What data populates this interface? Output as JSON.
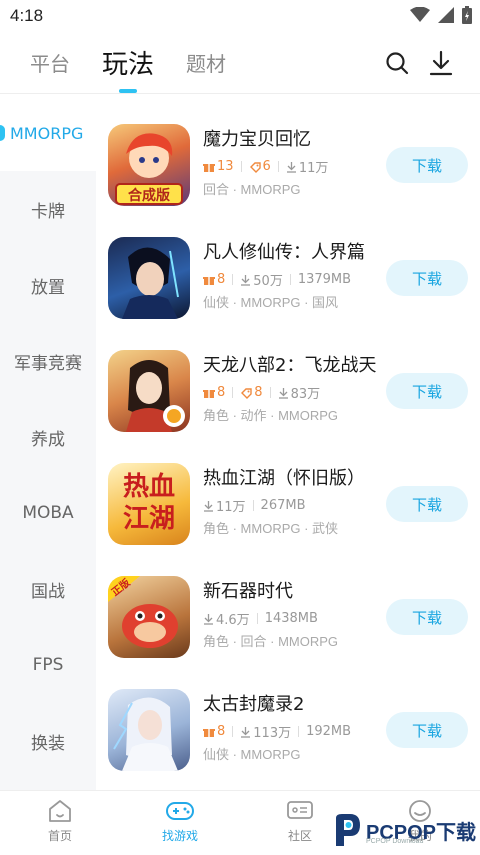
{
  "status_bar": {
    "time": "4:18"
  },
  "top_tabs": [
    {
      "label": "平台"
    },
    {
      "label": "玩法"
    },
    {
      "label": "题材"
    }
  ],
  "sidebar": [
    {
      "label": "MMORPG"
    },
    {
      "label": "卡牌"
    },
    {
      "label": "放置"
    },
    {
      "label": "军事竞赛"
    },
    {
      "label": "养成"
    },
    {
      "label": "MOBA"
    },
    {
      "label": "国战"
    },
    {
      "label": "FPS"
    },
    {
      "label": "换装"
    }
  ],
  "games": [
    {
      "title": "魔力宝贝回忆",
      "gifts": "13",
      "coupons": "6",
      "downloads": "11万",
      "size": "",
      "tags": "回合 · MMORPG",
      "button": "下载",
      "icon_label": "合成版"
    },
    {
      "title": "凡人修仙传：人界篇",
      "gifts": "8",
      "coupons": "",
      "downloads": "50万",
      "size": "1379MB",
      "tags": "仙侠 · MMORPG · 国风",
      "button": "下载",
      "icon_label": ""
    },
    {
      "title": "天龙八部2：飞龙战天",
      "gifts": "8",
      "coupons": "8",
      "downloads": "83万",
      "size": "",
      "tags": "角色 · 动作 · MMORPG",
      "button": "下载",
      "icon_label": ""
    },
    {
      "title": "热血江湖（怀旧版）",
      "gifts": "",
      "coupons": "",
      "downloads": "11万",
      "size": "267MB",
      "tags": "角色 · MMORPG · 武侠",
      "button": "下载",
      "icon_label": "热血江湖"
    },
    {
      "title": "新石器时代",
      "gifts": "",
      "coupons": "",
      "downloads": "4.6万",
      "size": "1438MB",
      "tags": "角色 · 回合 · MMORPG",
      "button": "下载",
      "icon_label": "正版"
    },
    {
      "title": "太古封魔录2",
      "gifts": "8",
      "coupons": "",
      "downloads": "113万",
      "size": "192MB",
      "tags": "仙侠 · MMORPG",
      "button": "下载",
      "icon_label": ""
    }
  ],
  "bottom_nav": [
    {
      "label": "首页"
    },
    {
      "label": "找游戏"
    },
    {
      "label": "社区"
    },
    {
      "label": "我的"
    }
  ],
  "watermark": {
    "text": "PCPOP",
    "text_cn": "下载",
    "sub": "PCPOP Download"
  },
  "colors": {
    "accent": "#2ec2f2",
    "button_bg": "#e3f5fc",
    "button_text": "#19a5e0",
    "gift": "#f08a3e"
  }
}
